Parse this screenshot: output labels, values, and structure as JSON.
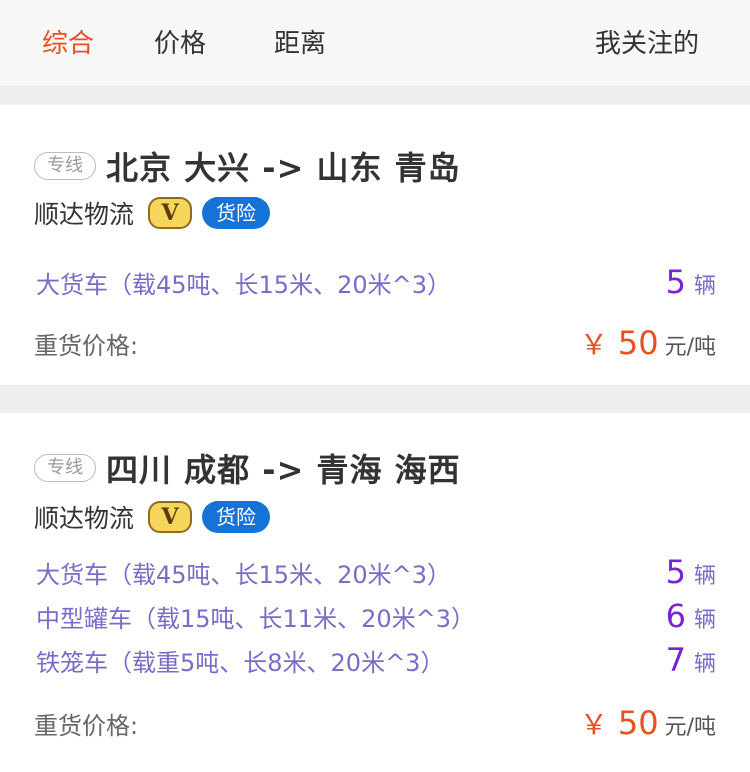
{
  "tabs": [
    "综合",
    "价格",
    "距离",
    "我关注的"
  ],
  "cards": [
    {
      "tag": "专线",
      "route": "北京 大兴 -> 山东 青岛",
      "company": "顺达物流",
      "vip_badge": "V",
      "insurance": "货险",
      "vehicles": [
        {
          "name": "大货车（载45吨、长15米、20米^3）",
          "count": "5",
          "unit": "辆"
        }
      ],
      "price_label": "重货价格:",
      "currency": "￥",
      "price": "50",
      "price_unit": "元/吨"
    },
    {
      "tag": "专线",
      "route": "四川 成都 -> 青海 海西",
      "company": "顺达物流",
      "vip_badge": "V",
      "insurance": "货险",
      "vehicles": [
        {
          "name": "大货车（载45吨、长15米、20米^3）",
          "count": "5",
          "unit": "辆"
        },
        {
          "name": "中型罐车（载15吨、长11米、20米^3）",
          "count": "6",
          "unit": "辆"
        },
        {
          "name": "铁笼车（载重5吨、长8米、20米^3）",
          "count": "7",
          "unit": "辆"
        }
      ],
      "price_label": "重货价格:",
      "currency": "￥",
      "price": "50",
      "price_unit": "元/吨"
    }
  ],
  "colors": {
    "active_tab": "#e8501f",
    "vehicle_text": "#7a6cc8",
    "count": "#7a22d8",
    "price": "#e8501f",
    "insurance_badge": "#1572d6",
    "vip_badge": "#f6d55c"
  }
}
